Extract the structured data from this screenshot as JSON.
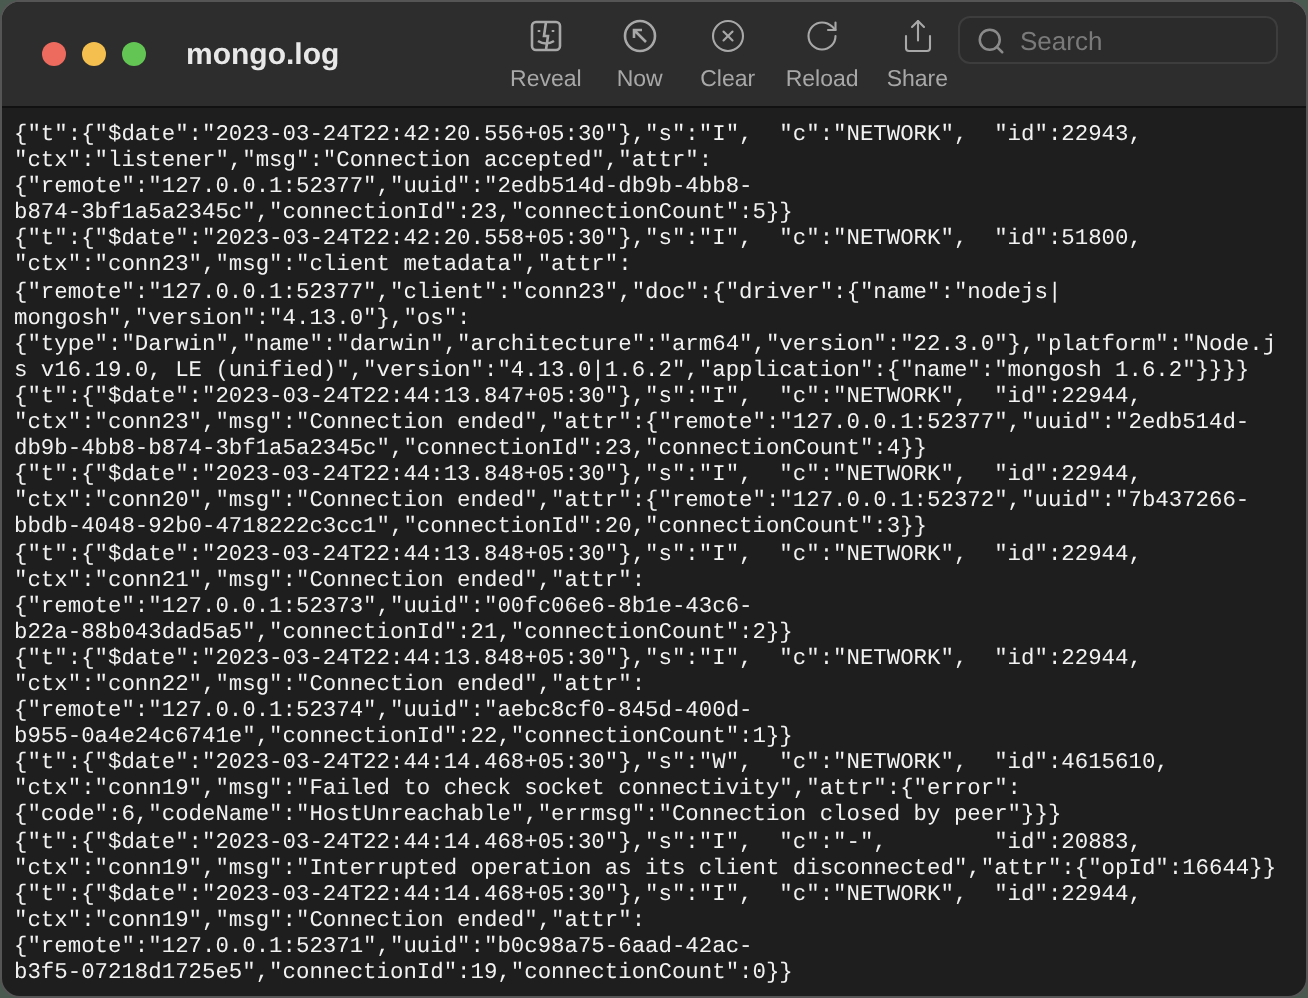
{
  "window": {
    "title": "mongo.log"
  },
  "toolbar": [
    {
      "kind": "reveal",
      "label": "Reveal"
    },
    {
      "kind": "now",
      "label": "Now"
    },
    {
      "kind": "clear",
      "label": "Clear"
    },
    {
      "kind": "reload",
      "label": "Reload"
    },
    {
      "kind": "share",
      "label": "Share"
    }
  ],
  "search": {
    "placeholder": "Search"
  },
  "log_lines": [
    "{\"t\":{\"$date\":\"2023-03-24T22:42:20.556+05:30\"},\"s\":\"I\",  \"c\":\"NETWORK\",  \"id\":22943,",
    "\"ctx\":\"listener\",\"msg\":\"Connection accepted\",\"attr\":",
    "{\"remote\":\"127.0.0.1:52377\",\"uuid\":\"2edb514d-db9b-4bb8-",
    "b874-3bf1a5a2345c\",\"connectionId\":23,\"connectionCount\":5}}",
    "{\"t\":{\"$date\":\"2023-03-24T22:42:20.558+05:30\"},\"s\":\"I\",  \"c\":\"NETWORK\",  \"id\":51800,",
    "\"ctx\":\"conn23\",\"msg\":\"client metadata\",\"attr\":",
    "{\"remote\":\"127.0.0.1:52377\",\"client\":\"conn23\",\"doc\":{\"driver\":{\"name\":\"nodejs|",
    "mongosh\",\"version\":\"4.13.0\"},\"os\":",
    "{\"type\":\"Darwin\",\"name\":\"darwin\",\"architecture\":\"arm64\",\"version\":\"22.3.0\"},\"platform\":\"Node.j",
    "s v16.19.0, LE (unified)\",\"version\":\"4.13.0|1.6.2\",\"application\":{\"name\":\"mongosh 1.6.2\"}}}}",
    "{\"t\":{\"$date\":\"2023-03-24T22:44:13.847+05:30\"},\"s\":\"I\",  \"c\":\"NETWORK\",  \"id\":22944,",
    "\"ctx\":\"conn23\",\"msg\":\"Connection ended\",\"attr\":{\"remote\":\"127.0.0.1:52377\",\"uuid\":\"2edb514d-",
    "db9b-4bb8-b874-3bf1a5a2345c\",\"connectionId\":23,\"connectionCount\":4}}",
    "{\"t\":{\"$date\":\"2023-03-24T22:44:13.848+05:30\"},\"s\":\"I\",  \"c\":\"NETWORK\",  \"id\":22944,",
    "\"ctx\":\"conn20\",\"msg\":\"Connection ended\",\"attr\":{\"remote\":\"127.0.0.1:52372\",\"uuid\":\"7b437266-",
    "bbdb-4048-92b0-4718222c3cc1\",\"connectionId\":20,\"connectionCount\":3}}",
    "{\"t\":{\"$date\":\"2023-03-24T22:44:13.848+05:30\"},\"s\":\"I\",  \"c\":\"NETWORK\",  \"id\":22944,",
    "\"ctx\":\"conn21\",\"msg\":\"Connection ended\",\"attr\":",
    "{\"remote\":\"127.0.0.1:52373\",\"uuid\":\"00fc06e6-8b1e-43c6-",
    "b22a-88b043dad5a5\",\"connectionId\":21,\"connectionCount\":2}}",
    "{\"t\":{\"$date\":\"2023-03-24T22:44:13.848+05:30\"},\"s\":\"I\",  \"c\":\"NETWORK\",  \"id\":22944,",
    "\"ctx\":\"conn22\",\"msg\":\"Connection ended\",\"attr\":",
    "{\"remote\":\"127.0.0.1:52374\",\"uuid\":\"aebc8cf0-845d-400d-",
    "b955-0a4e24c6741e\",\"connectionId\":22,\"connectionCount\":1}}",
    "{\"t\":{\"$date\":\"2023-03-24T22:44:14.468+05:30\"},\"s\":\"W\",  \"c\":\"NETWORK\",  \"id\":4615610,",
    "\"ctx\":\"conn19\",\"msg\":\"Failed to check socket connectivity\",\"attr\":{\"error\":",
    "{\"code\":6,\"codeName\":\"HostUnreachable\",\"errmsg\":\"Connection closed by peer\"}}}",
    "{\"t\":{\"$date\":\"2023-03-24T22:44:14.468+05:30\"},\"s\":\"I\",  \"c\":\"-\",        \"id\":20883,",
    "\"ctx\":\"conn19\",\"msg\":\"Interrupted operation as its client disconnected\",\"attr\":{\"opId\":16644}}",
    "{\"t\":{\"$date\":\"2023-03-24T22:44:14.468+05:30\"},\"s\":\"I\",  \"c\":\"NETWORK\",  \"id\":22944,",
    "\"ctx\":\"conn19\",\"msg\":\"Connection ended\",\"attr\":",
    "{\"remote\":\"127.0.0.1:52371\",\"uuid\":\"b0c98a75-6aad-42ac-",
    "b3f5-07218d1725e5\",\"connectionId\":19,\"connectionCount\":0}}"
  ]
}
